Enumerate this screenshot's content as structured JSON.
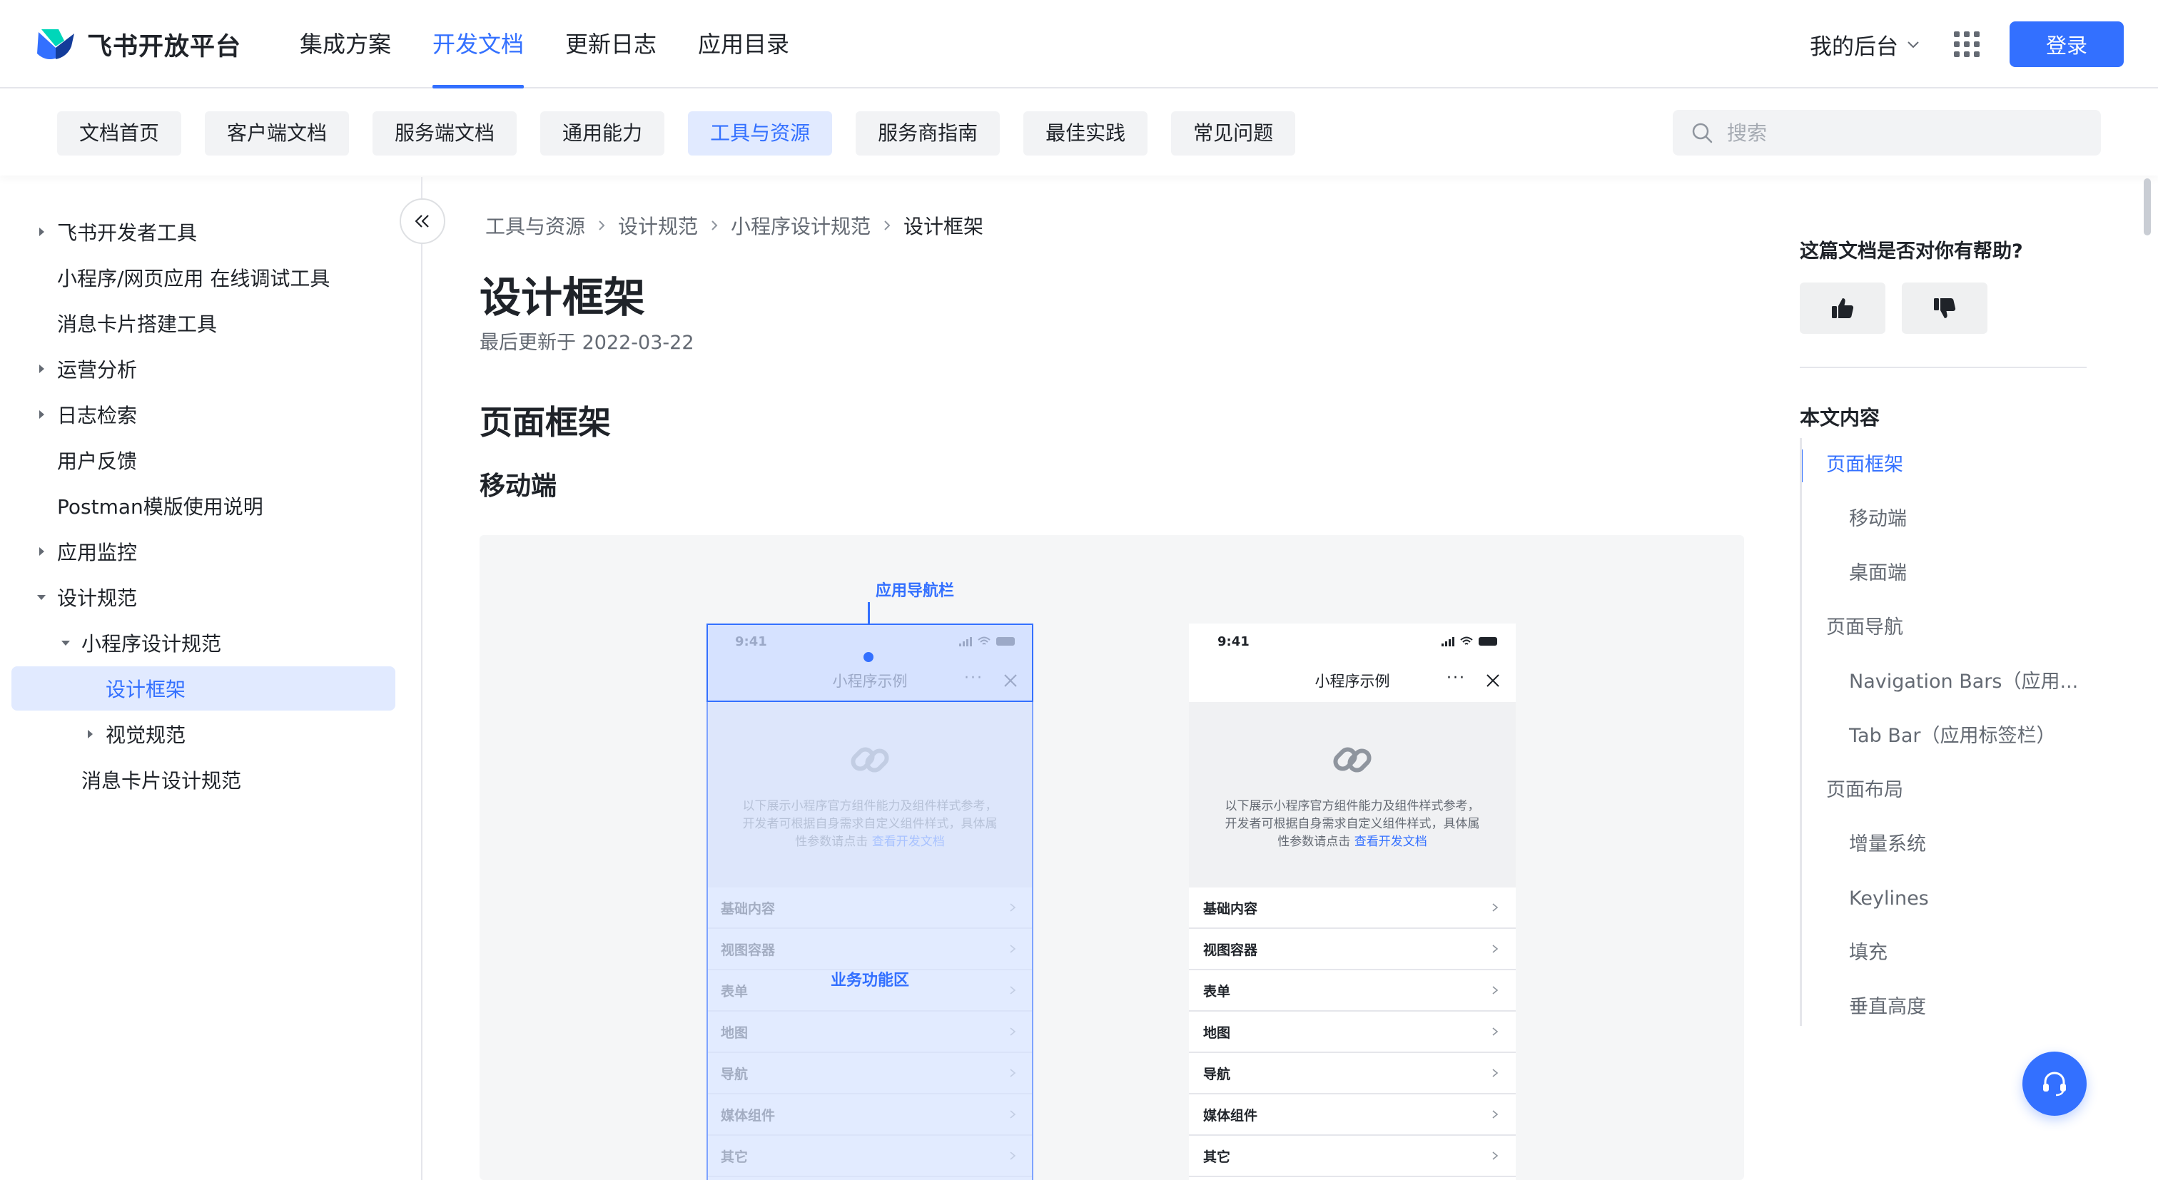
{
  "brand": {
    "name": "飞书开放平台",
    "accent": "#3370ff"
  },
  "topnav": [
    {
      "label": "集成方案",
      "active": false
    },
    {
      "label": "开发文档",
      "active": true
    },
    {
      "label": "更新日志",
      "active": false
    },
    {
      "label": "应用目录",
      "active": false
    }
  ],
  "header": {
    "console_label": "我的后台",
    "login_label": "登录"
  },
  "subnav": [
    {
      "label": "文档首页",
      "active": false
    },
    {
      "label": "客户端文档",
      "active": false
    },
    {
      "label": "服务端文档",
      "active": false
    },
    {
      "label": "通用能力",
      "active": false
    },
    {
      "label": "工具与资源",
      "active": true
    },
    {
      "label": "服务商指南",
      "active": false
    },
    {
      "label": "最佳实践",
      "active": false
    },
    {
      "label": "常见问题",
      "active": false
    }
  ],
  "search": {
    "placeholder": "搜索"
  },
  "sidebar": {
    "items": [
      {
        "label": "飞书开发者工具",
        "level": 0,
        "caret": "right",
        "selected": false
      },
      {
        "label": "小程序/网页应用 在线调试工具",
        "level": 0,
        "caret": "none",
        "selected": false
      },
      {
        "label": "消息卡片搭建工具",
        "level": 0,
        "caret": "none",
        "selected": false
      },
      {
        "label": "运营分析",
        "level": 0,
        "caret": "right",
        "selected": false
      },
      {
        "label": "日志检索",
        "level": 0,
        "caret": "right",
        "selected": false
      },
      {
        "label": "用户反馈",
        "level": 0,
        "caret": "none",
        "selected": false
      },
      {
        "label": "Postman模版使用说明",
        "level": 0,
        "caret": "none",
        "selected": false
      },
      {
        "label": "应用监控",
        "level": 0,
        "caret": "right",
        "selected": false
      },
      {
        "label": "设计规范",
        "level": 0,
        "caret": "down",
        "selected": false
      },
      {
        "label": "小程序设计规范",
        "level": 1,
        "caret": "down",
        "selected": false
      },
      {
        "label": "设计框架",
        "level": 2,
        "caret": "none",
        "selected": true
      },
      {
        "label": "视觉规范",
        "level": 2,
        "caret": "right",
        "selected": false
      },
      {
        "label": "消息卡片设计规范",
        "level": 1,
        "caret": "none",
        "selected": false
      }
    ]
  },
  "breadcrumb": [
    "工具与资源",
    "设计规范",
    "小程序设计规范",
    "设计框架"
  ],
  "page": {
    "title": "设计框架",
    "updated": "最后更新于 2022-03-22",
    "h2": "页面框架",
    "h3": "移动端"
  },
  "figure": {
    "callout_nav": "应用导航栏",
    "callout_body": "业务功能区",
    "phone": {
      "time": "9:41",
      "title": "小程序示例",
      "more": "···",
      "desc": "以下展示小程序官方组件能力及组件样式参考，开发者可根据自身需求自定义组件样式，具体属性参数请点击",
      "desc_link": "查看开发文档",
      "rows": [
        "基础内容",
        "视图容器",
        "表单",
        "地图",
        "导航",
        "媒体组件",
        "其它"
      ]
    }
  },
  "right_panel": {
    "feedback_question": "这篇文档是否对你有帮助?",
    "toc_title": "本文内容",
    "toc": [
      {
        "label": "页面框架",
        "level": 1,
        "active": true
      },
      {
        "label": "移动端",
        "level": 2,
        "active": false
      },
      {
        "label": "桌面端",
        "level": 2,
        "active": false
      },
      {
        "label": "页面导航",
        "level": 1,
        "active": false
      },
      {
        "label": "Navigation Bars（应用...",
        "level": 2,
        "active": false
      },
      {
        "label": "Tab Bar（应用标签栏）",
        "level": 2,
        "active": false
      },
      {
        "label": "页面布局",
        "level": 1,
        "active": false
      },
      {
        "label": "增量系统",
        "level": 2,
        "active": false
      },
      {
        "label": "Keylines",
        "level": 2,
        "active": false
      },
      {
        "label": "填充",
        "level": 2,
        "active": false
      },
      {
        "label": "垂直高度",
        "level": 2,
        "active": false
      }
    ]
  }
}
